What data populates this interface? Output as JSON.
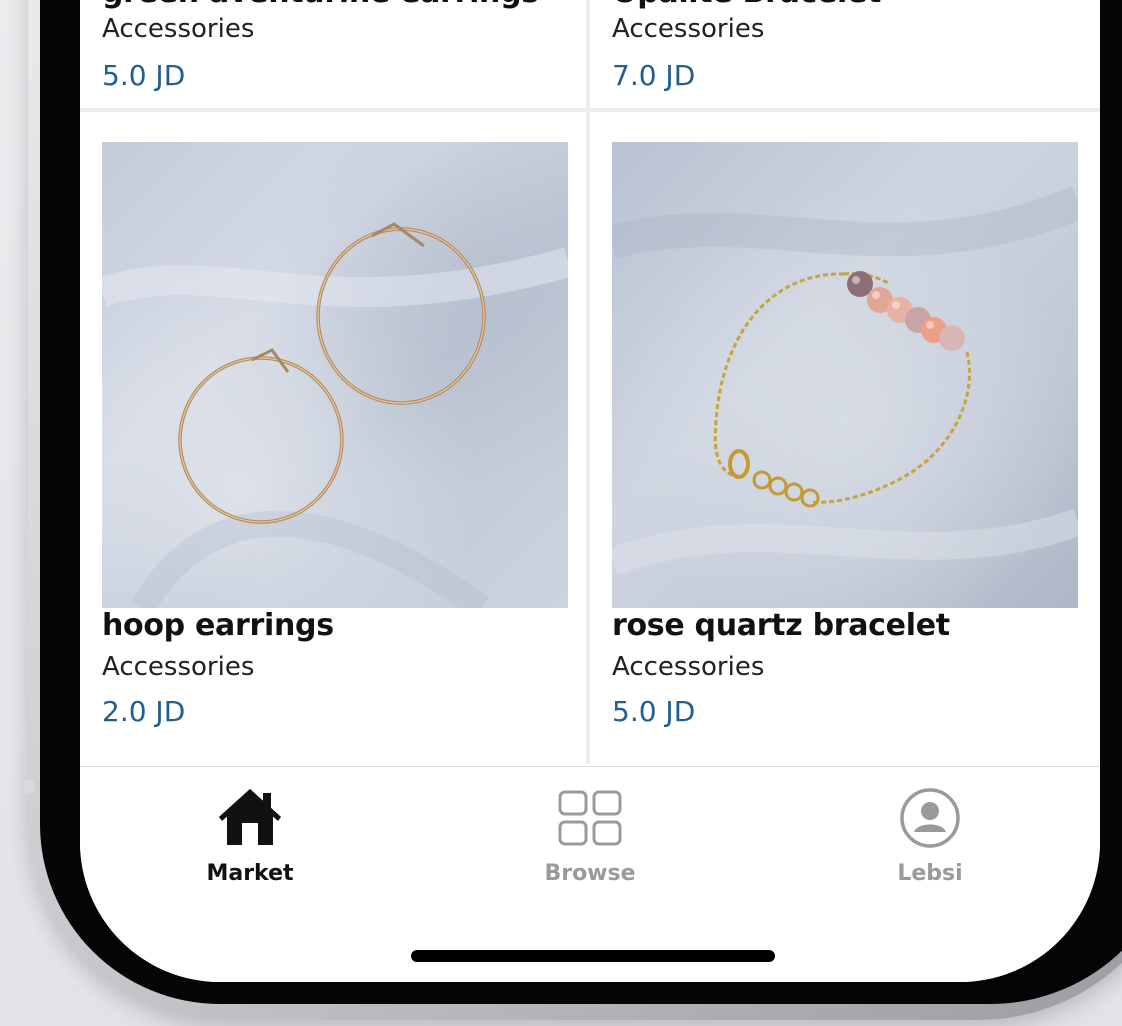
{
  "products": [
    {
      "name": "green aventurine earrings",
      "category": "Accessories",
      "price": "5.0 JD"
    },
    {
      "name": "Opalite Bracelet",
      "category": "Accessories",
      "price": "7.0 JD"
    },
    {
      "name": "hoop earrings",
      "category": "Accessories",
      "price": "2.0 JD"
    },
    {
      "name": "rose quartz bracelet",
      "category": "Accessories",
      "price": "5.0 JD"
    }
  ],
  "tabbar": {
    "tabs": [
      {
        "label": "Market",
        "icon": "house-icon",
        "active": true
      },
      {
        "label": "Browse",
        "icon": "grid-icon",
        "active": false
      },
      {
        "label": "Lebsi",
        "icon": "user-circle-icon",
        "active": false
      }
    ]
  },
  "colors": {
    "price": "#1f5f93",
    "active_tab": "#111111",
    "inactive_tab": "#9a9a9a"
  }
}
